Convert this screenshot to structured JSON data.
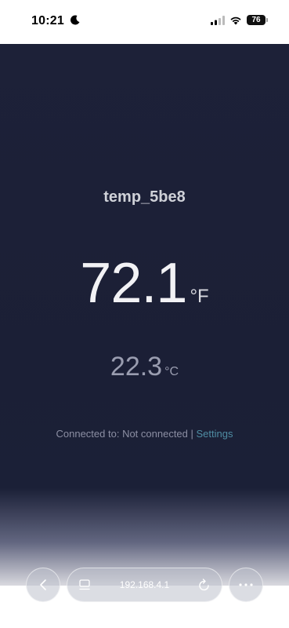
{
  "status_bar": {
    "time": "10:21",
    "battery": "76",
    "icons": [
      "moon-icon",
      "signal-icon",
      "wifi-icon",
      "battery-icon"
    ]
  },
  "page": {
    "device_name": "temp_5be8",
    "temp_f": {
      "value": "72.1",
      "unit": "°F"
    },
    "temp_c": {
      "value": "22.3",
      "unit": "°C"
    },
    "connection_prefix": "Connected to: ",
    "connection_status": "Not connected",
    "separator": " | ",
    "settings_link": "Settings"
  },
  "browser": {
    "url": "192.168.4.1",
    "buttons": [
      "back",
      "tabs",
      "reload",
      "more"
    ]
  },
  "colors": {
    "background": "#1d2138",
    "link": "#4f8da3",
    "primary_text": "#f2f2f5",
    "secondary_text": "#9a9db0"
  }
}
